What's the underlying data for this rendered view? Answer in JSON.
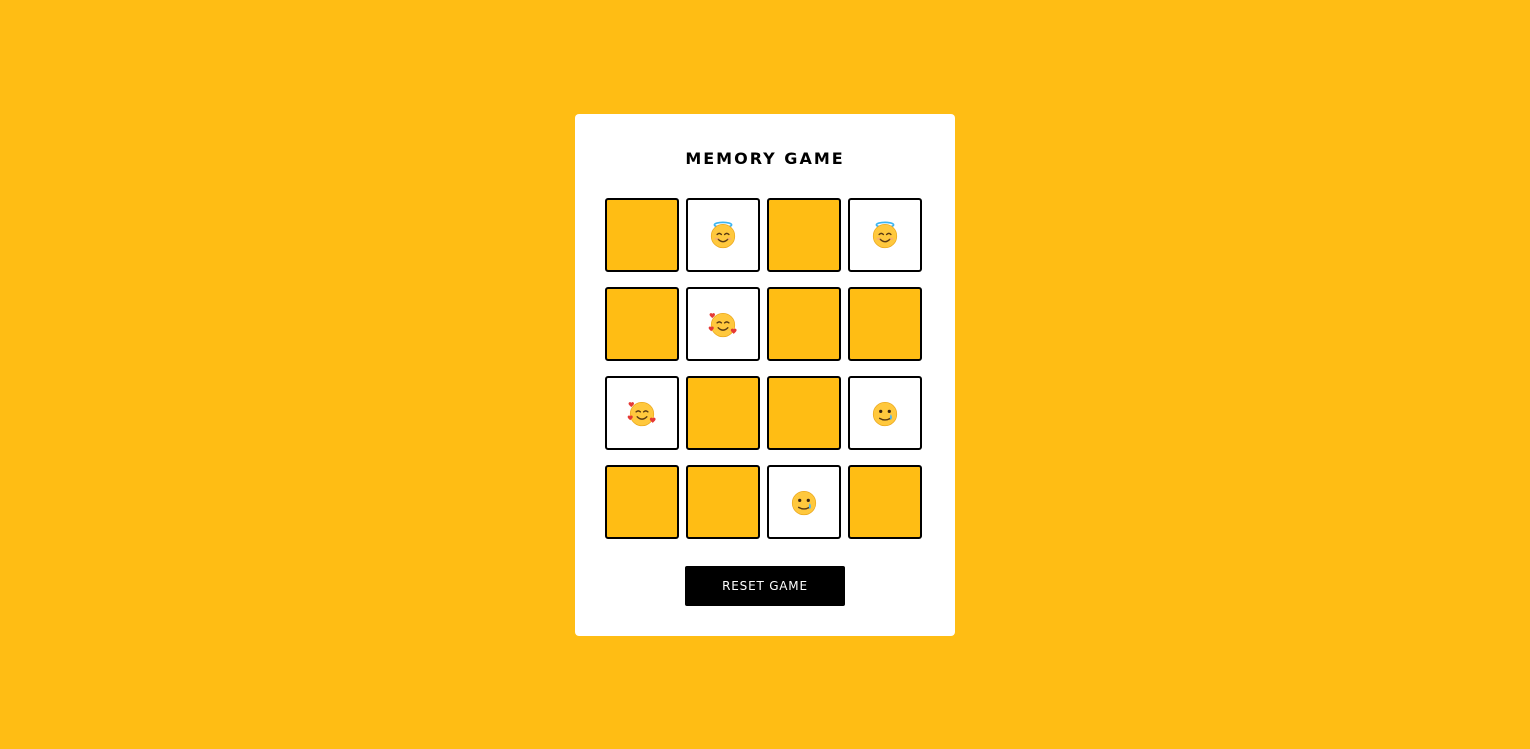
{
  "title": "MEMORY GAME",
  "reset_label": "RESET GAME",
  "colors": {
    "background": "#FFBD14",
    "panel": "#FFFFFF",
    "card_hidden": "#FFBD14",
    "card_revealed": "#FFFFFF",
    "card_border": "#000000",
    "button": "#000000",
    "button_text": "#FFFFFF"
  },
  "cards": [
    {
      "revealed": false,
      "emoji": ""
    },
    {
      "revealed": true,
      "emoji": "smiling-face-with-halo"
    },
    {
      "revealed": false,
      "emoji": ""
    },
    {
      "revealed": true,
      "emoji": "smiling-face-with-halo"
    },
    {
      "revealed": false,
      "emoji": ""
    },
    {
      "revealed": true,
      "emoji": "smiling-face-with-hearts"
    },
    {
      "revealed": false,
      "emoji": ""
    },
    {
      "revealed": false,
      "emoji": ""
    },
    {
      "revealed": true,
      "emoji": "smiling-face-with-hearts"
    },
    {
      "revealed": false,
      "emoji": ""
    },
    {
      "revealed": false,
      "emoji": ""
    },
    {
      "revealed": true,
      "emoji": "face-holding-back-tears"
    },
    {
      "revealed": false,
      "emoji": ""
    },
    {
      "revealed": false,
      "emoji": ""
    },
    {
      "revealed": true,
      "emoji": "face-holding-back-tears"
    },
    {
      "revealed": false,
      "emoji": ""
    }
  ]
}
